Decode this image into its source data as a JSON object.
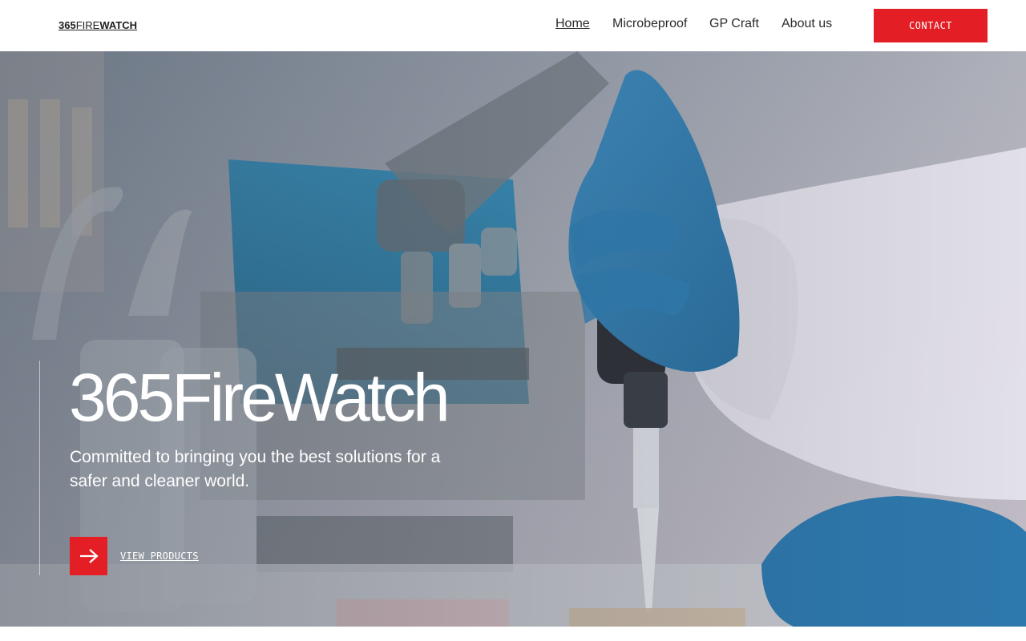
{
  "header": {
    "logo": {
      "part1": "365",
      "part2": "FIRE",
      "part3": "WATCH"
    },
    "nav": [
      {
        "label": "Home",
        "active": true
      },
      {
        "label": "Microbeproof",
        "active": false
      },
      {
        "label": "GP Craft",
        "active": false
      },
      {
        "label": "About us",
        "active": false
      }
    ],
    "contact_label": "CONTACT"
  },
  "hero": {
    "title": "365FireWatch",
    "subtitle": "Committed to bringing you the best solutions for a safer and cleaner world.",
    "cta_label": "VIEW PRODUCTS",
    "arrow_icon": "arrow-right-icon"
  },
  "colors": {
    "accent": "#e31e24",
    "text_dark": "#2b2b2b",
    "hero_text": "#ffffff"
  }
}
